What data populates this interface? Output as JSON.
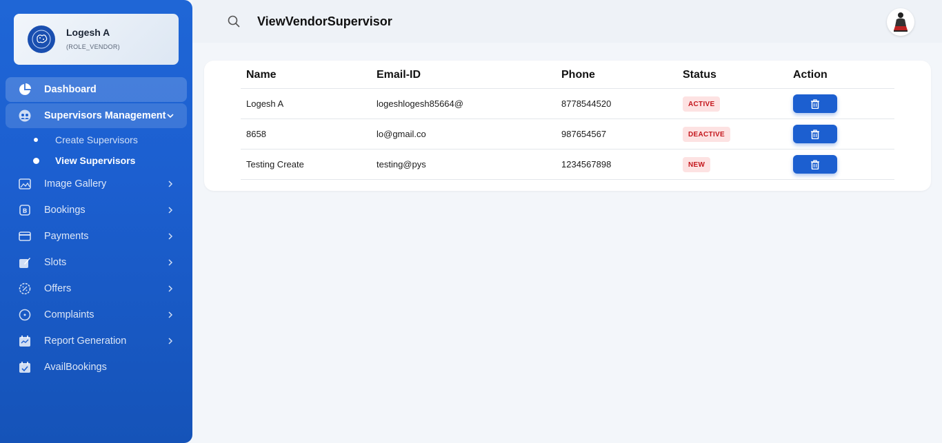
{
  "profile": {
    "name": "Logesh A",
    "role": "(ROLE_VENDOR)"
  },
  "header": {
    "title": "ViewVendorSupervisor"
  },
  "sidebar": {
    "items": [
      {
        "label": "Dashboard",
        "icon": "pie-chart-icon"
      },
      {
        "label": "Supervisors Management",
        "icon": "users-icon"
      },
      {
        "label": "Image Gallery",
        "icon": "image-icon"
      },
      {
        "label": "Bookings",
        "icon": "bookings-icon"
      },
      {
        "label": "Payments",
        "icon": "credit-card-icon"
      },
      {
        "label": "Slots",
        "icon": "edit-icon"
      },
      {
        "label": "Offers",
        "icon": "percent-badge-icon"
      },
      {
        "label": "Complaints",
        "icon": "circle-dot-icon"
      },
      {
        "label": "Report Generation",
        "icon": "calendar-report-icon"
      },
      {
        "label": "AvailBookings",
        "icon": "calendar-check-icon"
      }
    ],
    "subitems": [
      {
        "label": "Create Supervisors"
      },
      {
        "label": "View Supervisors"
      }
    ]
  },
  "table": {
    "columns": [
      "Name",
      "Email-ID",
      "Phone",
      "Status",
      "Action"
    ],
    "rows": [
      {
        "name": "Logesh A",
        "email": "logeshlogesh85664@",
        "phone": "8778544520",
        "status": "ACTIVE"
      },
      {
        "name": "8658",
        "email": "lo@gmail.co",
        "phone": "987654567",
        "status": "DEACTIVE"
      },
      {
        "name": "Testing Create",
        "email": "testing@pys",
        "phone": "1234567898",
        "status": "NEW"
      }
    ]
  },
  "colors": {
    "primary": "#1c5fd0",
    "badge_bg": "#fde2e2",
    "badge_text": "#c4161c",
    "background": "#f3f6fa"
  }
}
